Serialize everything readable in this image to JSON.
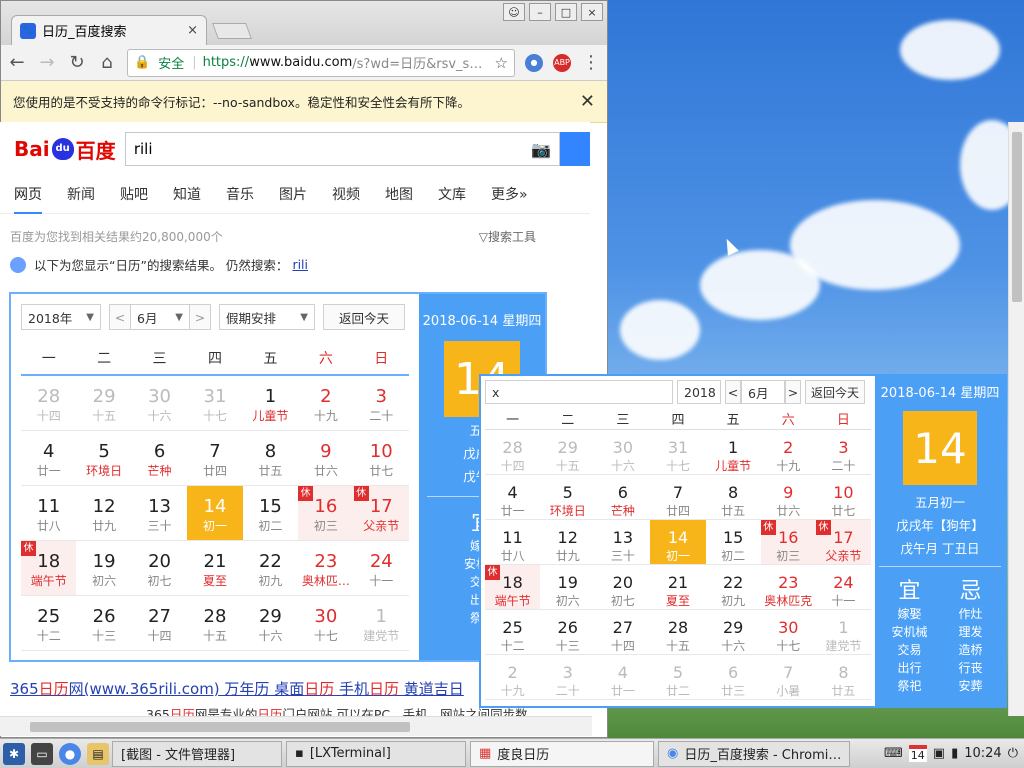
{
  "browser": {
    "tab_title": "日历_百度搜索",
    "tab_close": "×",
    "window_buttons": [
      "☺",
      "–",
      "□",
      "×"
    ],
    "security_label": "安全",
    "url_proto": "https://",
    "url_host": "www.baidu.com",
    "url_path": "/s?wd=日历&rsv_s…",
    "warning": "您使用的是不受支持的命令行标记：--no-sandbox。稳定性和安全性会有所下降。",
    "ext_abp": "ABP"
  },
  "baidu": {
    "logo_left": "Bai",
    "logo_paw": "du",
    "logo_right": "百度",
    "query": "rili",
    "tabs": [
      "网页",
      "新闻",
      "贴吧",
      "知道",
      "音乐",
      "图片",
      "视频",
      "地图",
      "文库",
      "更多»"
    ],
    "result_count": "百度为您找到相关结果约20,800,000个",
    "search_tools": "搜索工具",
    "hint_prefix": "以下为您显示“日历”的搜索结果。 仍然搜索：",
    "hint_link": "rili"
  },
  "cal_page": {
    "year": "2018年",
    "prev": "<",
    "month": "6月",
    "next": ">",
    "holiday_select": "假期安排",
    "today_btn": "返回今天",
    "weekdays": [
      "一",
      "二",
      "三",
      "四",
      "五",
      "六",
      "日"
    ],
    "date_header": "2018-06-14 星期四",
    "big_day": "14",
    "lunar": "五月",
    "ganzhi_year": "戊戌年",
    "ganzhi_month": "戊午月",
    "yi": "宜",
    "yi_items": [
      "嫁娶",
      "安机械",
      "交易",
      "出行",
      "祭祀"
    ],
    "days": [
      [
        "28",
        "十四",
        "o"
      ],
      [
        "29",
        "十五",
        "o"
      ],
      [
        "30",
        "十六",
        "o"
      ],
      [
        "31",
        "十七",
        "o"
      ],
      [
        "1",
        "儿童节",
        "f"
      ],
      [
        "2",
        "十九",
        "r"
      ],
      [
        "3",
        "二十",
        "r"
      ],
      [
        "4",
        "廿一",
        ""
      ],
      [
        "5",
        "环境日",
        "f"
      ],
      [
        "6",
        "芒种",
        "f"
      ],
      [
        "7",
        "廿四",
        ""
      ],
      [
        "8",
        "廿五",
        ""
      ],
      [
        "9",
        "廿六",
        "r"
      ],
      [
        "10",
        "廿七",
        "r"
      ],
      [
        "11",
        "廿八",
        ""
      ],
      [
        "12",
        "廿九",
        ""
      ],
      [
        "13",
        "三十",
        ""
      ],
      [
        "14",
        "初一",
        "t"
      ],
      [
        "15",
        "初二",
        ""
      ],
      [
        "16",
        "初三",
        "rh"
      ],
      [
        "17",
        "父亲节",
        "rfh"
      ],
      [
        "18",
        "端午节",
        "fh"
      ],
      [
        "19",
        "初六",
        ""
      ],
      [
        "20",
        "初七",
        ""
      ],
      [
        "21",
        "夏至",
        "f"
      ],
      [
        "22",
        "初九",
        ""
      ],
      [
        "23",
        "奥林匹…",
        "rf"
      ],
      [
        "24",
        "十一",
        "r"
      ],
      [
        "25",
        "十二",
        ""
      ],
      [
        "26",
        "十三",
        ""
      ],
      [
        "27",
        "十四",
        ""
      ],
      [
        "28",
        "十五",
        ""
      ],
      [
        "29",
        "十六",
        ""
      ],
      [
        "30",
        "十七",
        "r"
      ],
      [
        "1",
        "建党节",
        "o"
      ]
    ]
  },
  "cal_widget": {
    "search_value": "x",
    "year": "2018",
    "prev": "<",
    "month": "6月",
    "next": ">",
    "today_btn": "返回今天",
    "weekdays": [
      "一",
      "二",
      "三",
      "四",
      "五",
      "六",
      "日"
    ],
    "date_header": "2018-06-14 星期四",
    "big_day": "14",
    "lunar": "五月初一",
    "ganzhi_year": "戊戌年【狗年】",
    "ganzhi_month": "戊午月 丁丑日",
    "yi": "宜",
    "ji": "忌",
    "yi_items": [
      "嫁娶",
      "安机械",
      "交易",
      "出行",
      "祭祀"
    ],
    "ji_items": [
      "作灶",
      "理发",
      "造桥",
      "行丧",
      "安葬"
    ],
    "days": [
      [
        "28",
        "十四",
        "o"
      ],
      [
        "29",
        "十五",
        "o"
      ],
      [
        "30",
        "十六",
        "o"
      ],
      [
        "31",
        "十七",
        "o"
      ],
      [
        "1",
        "儿童节",
        "f"
      ],
      [
        "2",
        "十九",
        "r"
      ],
      [
        "3",
        "二十",
        "r"
      ],
      [
        "4",
        "廿一",
        ""
      ],
      [
        "5",
        "环境日",
        "f"
      ],
      [
        "6",
        "芒种",
        "f"
      ],
      [
        "7",
        "廿四",
        ""
      ],
      [
        "8",
        "廿五",
        ""
      ],
      [
        "9",
        "廿六",
        "r"
      ],
      [
        "10",
        "廿七",
        "r"
      ],
      [
        "11",
        "廿八",
        ""
      ],
      [
        "12",
        "廿九",
        ""
      ],
      [
        "13",
        "三十",
        ""
      ],
      [
        "14",
        "初一",
        "t"
      ],
      [
        "15",
        "初二",
        ""
      ],
      [
        "16",
        "初三",
        "rh"
      ],
      [
        "17",
        "父亲节",
        "rfh"
      ],
      [
        "18",
        "端午节",
        "fh"
      ],
      [
        "19",
        "初六",
        ""
      ],
      [
        "20",
        "初七",
        ""
      ],
      [
        "21",
        "夏至",
        "f"
      ],
      [
        "22",
        "初九",
        ""
      ],
      [
        "23",
        "奥林匹克",
        "rf"
      ],
      [
        "24",
        "十一",
        "r"
      ],
      [
        "25",
        "十二",
        ""
      ],
      [
        "26",
        "十三",
        ""
      ],
      [
        "27",
        "十四",
        ""
      ],
      [
        "28",
        "十五",
        ""
      ],
      [
        "29",
        "十六",
        ""
      ],
      [
        "30",
        "十七",
        "r"
      ],
      [
        "1",
        "建党节",
        "o"
      ],
      [
        "2",
        "十九",
        "o"
      ],
      [
        "3",
        "二十",
        "o"
      ],
      [
        "4",
        "廿一",
        "o"
      ],
      [
        "5",
        "廿二",
        "o"
      ],
      [
        "6",
        "廿三",
        "o"
      ],
      [
        "7",
        "小暑",
        "o"
      ],
      [
        "8",
        "廿五",
        "o"
      ]
    ],
    "xiu": "休"
  },
  "results": {
    "title_parts": [
      "365",
      "日历",
      "网(www.365rili.com) 万年历 桌面",
      "日历",
      " 手机",
      "日历",
      " 黄道吉日"
    ],
    "snippet_parts": [
      "365",
      "日历",
      "网是专业的",
      "日历",
      "门户网站,可以在PC、手机、网站之间同步数"
    ]
  },
  "taskbar": {
    "tasks": [
      "[截图 - 文件管理器]",
      "[LXTerminal]",
      "度良日历",
      "日历_百度搜索 - Chromi…"
    ],
    "cal_icon_day": "14",
    "clock": "10:24"
  },
  "colors": {
    "accent": "#4ba0f6",
    "today": "#f8b51a",
    "holiday_red": "#e02d2d",
    "baidu_blue": "#3385ff"
  }
}
